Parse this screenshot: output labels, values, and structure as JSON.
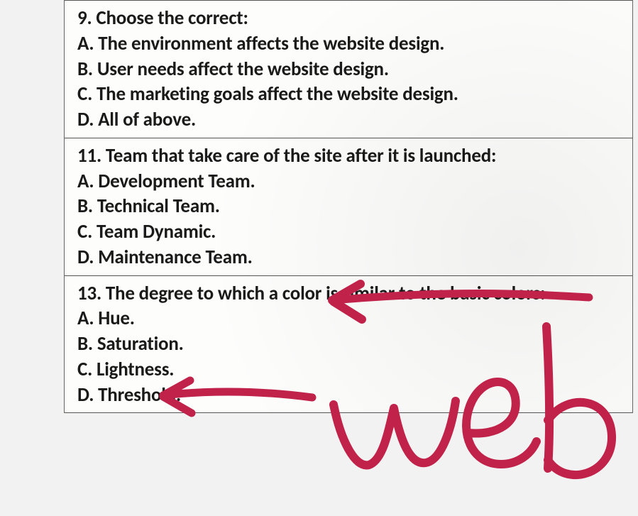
{
  "questions": [
    {
      "prompt": "9. Choose the correct:",
      "options": [
        "A. The environment affects the website design.",
        "B. User needs affect the website design.",
        "C. The marketing goals affect the website design.",
        "D. All of above."
      ]
    },
    {
      "prompt": "11. Team that take care of the site after it is launched:",
      "options": [
        "A. Development Team.",
        "B. Technical Team.",
        "C. Team Dynamic.",
        "D. Maintenance Team."
      ]
    },
    {
      "prompt": "13. The degree to which a color is similar to the basic colors:",
      "options": [
        "A. Hue.",
        "B. Saturation.",
        "C. Lightness.",
        "D. Threshold."
      ]
    }
  ],
  "annotations": {
    "handwriting": "web",
    "color": "#c0224a"
  }
}
